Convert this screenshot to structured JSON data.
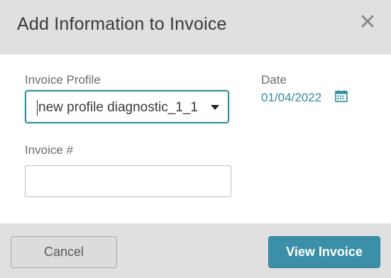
{
  "dialog": {
    "title": "Add Information to Invoice",
    "close_icon": "close-icon"
  },
  "form": {
    "profile": {
      "label": "Invoice Profile",
      "selected": "new profile diagnostic_1_1"
    },
    "date": {
      "label": "Date",
      "value": "01/04/2022",
      "icon": "calendar-icon"
    },
    "invoice_number": {
      "label": "Invoice #",
      "value": "",
      "placeholder": ""
    }
  },
  "footer": {
    "cancel_label": "Cancel",
    "view_label": "View Invoice"
  },
  "colors": {
    "accent": "#2f8da0",
    "primary_button": "#3b8fa8",
    "header_bg": "#e0e0e0"
  }
}
